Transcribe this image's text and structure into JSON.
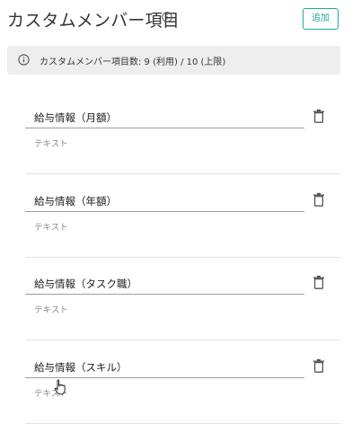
{
  "header": {
    "title": "カスタムメンバー項目",
    "info_icon": "info-icon",
    "add_label": "追加",
    "accent_color": "#26a69a"
  },
  "banner": {
    "icon": "info-icon",
    "text": "カスタムメンバー項目数: 9 (利用) / 10 (上限)",
    "background": "#eeeeee"
  },
  "items": [
    {
      "name": "給与情報（月額）",
      "type": "テキスト",
      "delete_icon": "trash-icon"
    },
    {
      "name": "給与情報（年額）",
      "type": "テキスト",
      "delete_icon": "trash-icon"
    },
    {
      "name": "給与情報（タスク職）",
      "type": "テキスト",
      "delete_icon": "trash-icon"
    },
    {
      "name": "給与情報（スキル）",
      "type": "テキスト",
      "delete_icon": "trash-icon"
    }
  ],
  "cursor": {
    "icon": "hand-pointer-icon"
  }
}
